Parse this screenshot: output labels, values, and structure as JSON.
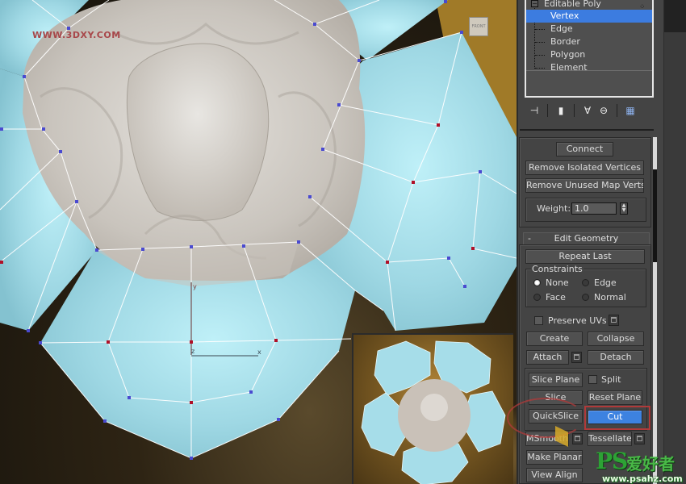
{
  "viewport": {
    "watermark": "WWW.3DXY.COM",
    "viewcube_label": "FRONT",
    "gizmo": {
      "y_label": "y",
      "z_label": "z",
      "x_label": "x"
    },
    "colors": {
      "mesh_fill": "#a9e0ec",
      "core_fill": "#cdc8c1",
      "edge": "#ffffff",
      "vertex": "#4a4ad0",
      "selected_vertex": "#b01028",
      "background": "#2e2414"
    }
  },
  "modifier_stack": {
    "root": "Editable Poly",
    "items": [
      {
        "label": "Vertex",
        "selected": true
      },
      {
        "label": "Edge",
        "selected": false
      },
      {
        "label": "Border",
        "selected": false
      },
      {
        "label": "Polygon",
        "selected": false
      },
      {
        "label": "Element",
        "selected": false
      }
    ]
  },
  "stack_toolbar": [
    {
      "name": "pin-stack-icon",
      "glyph": "⊣"
    },
    {
      "name": "show-end-result-icon",
      "glyph": "▮"
    },
    {
      "name": "make-unique-icon",
      "glyph": "∀"
    },
    {
      "name": "remove-modifier-icon",
      "glyph": "⊖"
    },
    {
      "name": "configure-modifier-sets-icon",
      "glyph": "▦"
    }
  ],
  "edit_vertices": {
    "connect": "Connect",
    "remove_isolated": "Remove Isolated Vertices",
    "remove_unused_map": "Remove Unused Map Verts",
    "weight_label": "Weight:",
    "weight_value": "1.0"
  },
  "edit_geometry": {
    "title": "Edit Geometry",
    "collapse_symbol": "-",
    "repeat_last": "Repeat Last",
    "constraints_label": "Constraints",
    "constraints": [
      {
        "label": "None",
        "checked": true
      },
      {
        "label": "Edge",
        "checked": false
      },
      {
        "label": "Face",
        "checked": false
      },
      {
        "label": "Normal",
        "checked": false
      }
    ],
    "preserve_uvs": "Preserve UVs",
    "preserve_uvs_checked": false,
    "create": "Create",
    "collapse": "Collapse",
    "attach": "Attach",
    "detach": "Detach",
    "slice_plane": "Slice Plane",
    "split": "Split",
    "split_checked": false,
    "slice": "Slice",
    "reset_plane": "Reset Plane",
    "quickslice": "QuickSlice",
    "cut": "Cut",
    "cut_active": true,
    "msmooth": "MSmooth",
    "tessellate": "Tessellate",
    "make_planar": "Make Planar",
    "view_align": "View Align"
  },
  "site_watermark": {
    "ps": "PS",
    "cn": "爱好者",
    "url": "www.psahz.com"
  }
}
